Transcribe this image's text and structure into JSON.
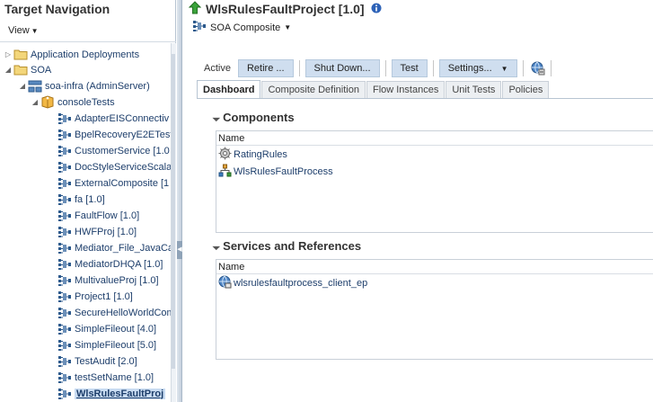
{
  "nav": {
    "title": "Target Navigation",
    "view_label": "View",
    "tree": [
      {
        "label": "Application Deployments",
        "icon": "folder-icon",
        "toggle": "expand"
      },
      {
        "label": "SOA",
        "icon": "folder-icon",
        "toggle": "collapse"
      },
      {
        "label": "soa-infra (AdminServer)",
        "icon": "soa-infra-icon",
        "toggle": "collapse"
      },
      {
        "label": "consoleTests",
        "icon": "partition-icon",
        "toggle": "collapse"
      },
      {
        "label": "AdapterEISConnectiv",
        "icon": "composite-icon"
      },
      {
        "label": "BpelRecoveryE2ETest",
        "icon": "composite-icon"
      },
      {
        "label": "CustomerService [1.0",
        "icon": "composite-icon"
      },
      {
        "label": "DocStyleServiceScalar",
        "icon": "composite-icon"
      },
      {
        "label": "ExternalComposite [1",
        "icon": "composite-icon"
      },
      {
        "label": "fa [1.0]",
        "icon": "composite-icon"
      },
      {
        "label": "FaultFlow [1.0]",
        "icon": "composite-icon"
      },
      {
        "label": "HWFProj [1.0]",
        "icon": "composite-icon"
      },
      {
        "label": "Mediator_File_JavaCa",
        "icon": "composite-icon"
      },
      {
        "label": "MediatorDHQA [1.0]",
        "icon": "composite-icon"
      },
      {
        "label": "MultivalueProj [1.0]",
        "icon": "composite-icon"
      },
      {
        "label": "Project1 [1.0]",
        "icon": "composite-icon"
      },
      {
        "label": "SecureHelloWorldCom",
        "icon": "composite-icon"
      },
      {
        "label": "SimpleFileout [4.0]",
        "icon": "composite-icon"
      },
      {
        "label": "SimpleFileout [5.0]",
        "icon": "composite-icon"
      },
      {
        "label": "TestAudit [2.0]",
        "icon": "composite-icon"
      },
      {
        "label": "testSetName [1.0]",
        "icon": "composite-icon"
      },
      {
        "label": "WlsRulesFaultProj",
        "icon": "composite-icon",
        "selected": true
      }
    ]
  },
  "page": {
    "title": "WlsRulesFaultProject [1.0]",
    "subtitle": "SOA Composite",
    "status": "Active"
  },
  "toolbar": {
    "retire": "Retire ...",
    "shutdown": "Shut Down...",
    "test": "Test",
    "settings": "Settings..."
  },
  "tabs": [
    {
      "label": "Dashboard",
      "active": true
    },
    {
      "label": "Composite Definition"
    },
    {
      "label": "Flow Instances"
    },
    {
      "label": "Unit Tests"
    },
    {
      "label": "Policies"
    }
  ],
  "components": {
    "title": "Components",
    "column": "Name",
    "rows": [
      {
        "label": "RatingRules",
        "icon": "rules-icon"
      },
      {
        "label": "WlsRulesFaultProcess",
        "icon": "bpel-process-icon"
      }
    ]
  },
  "services": {
    "title": "Services and References",
    "column": "Name",
    "rows": [
      {
        "label": "wlsrulesfaultprocess_client_ep",
        "icon": "web-service-icon"
      }
    ]
  },
  "colors": {
    "button_bg": "#cfdeef",
    "link": "#1d3e6b",
    "selection": "#c9dcf2"
  }
}
